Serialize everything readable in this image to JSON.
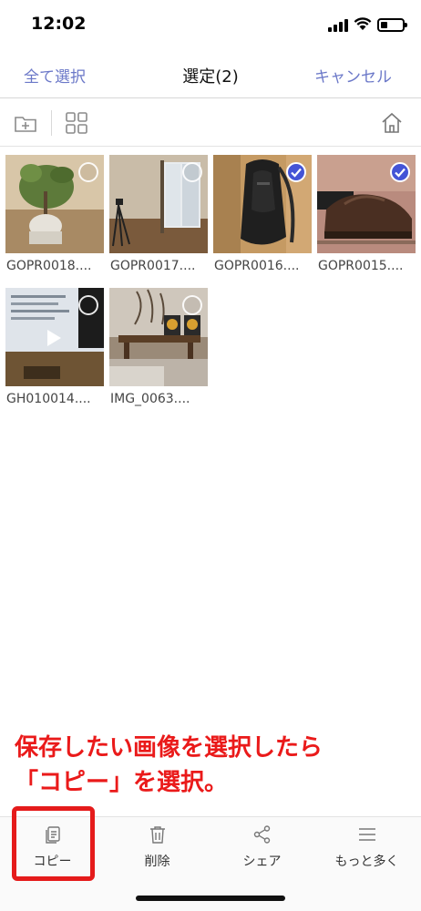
{
  "status_bar": {
    "time": "12:02"
  },
  "nav": {
    "select_all": "全て選択",
    "title": "選定(2)",
    "cancel": "キャンセル"
  },
  "toolbar": {
    "icons": [
      "folder-add-icon",
      "grid-view-icon",
      "home-icon"
    ]
  },
  "files": [
    {
      "name": "GOPR0018....",
      "selected": false,
      "type": "photo"
    },
    {
      "name": "GOPR0017....",
      "selected": false,
      "type": "photo"
    },
    {
      "name": "GOPR0016....",
      "selected": true,
      "type": "photo"
    },
    {
      "name": "GOPR0015....",
      "selected": true,
      "type": "photo"
    },
    {
      "name": "GH010014....",
      "selected": false,
      "type": "video"
    },
    {
      "name": "IMG_0063....",
      "selected": false,
      "type": "photo"
    }
  ],
  "annotation": {
    "line1": "保存したい画像を選択したら",
    "line2": "「コピー」を選択。"
  },
  "tab_bar": {
    "items": [
      {
        "label": "コピー",
        "icon": "copy-icon"
      },
      {
        "label": "削除",
        "icon": "trash-icon"
      },
      {
        "label": "シェア",
        "icon": "share-icon"
      },
      {
        "label": "もっと多く",
        "icon": "menu-icon"
      }
    ]
  },
  "colors": {
    "accent": "#6b78c8",
    "check_selected": "#4454d6",
    "annotation_red": "#ea1a1a"
  }
}
